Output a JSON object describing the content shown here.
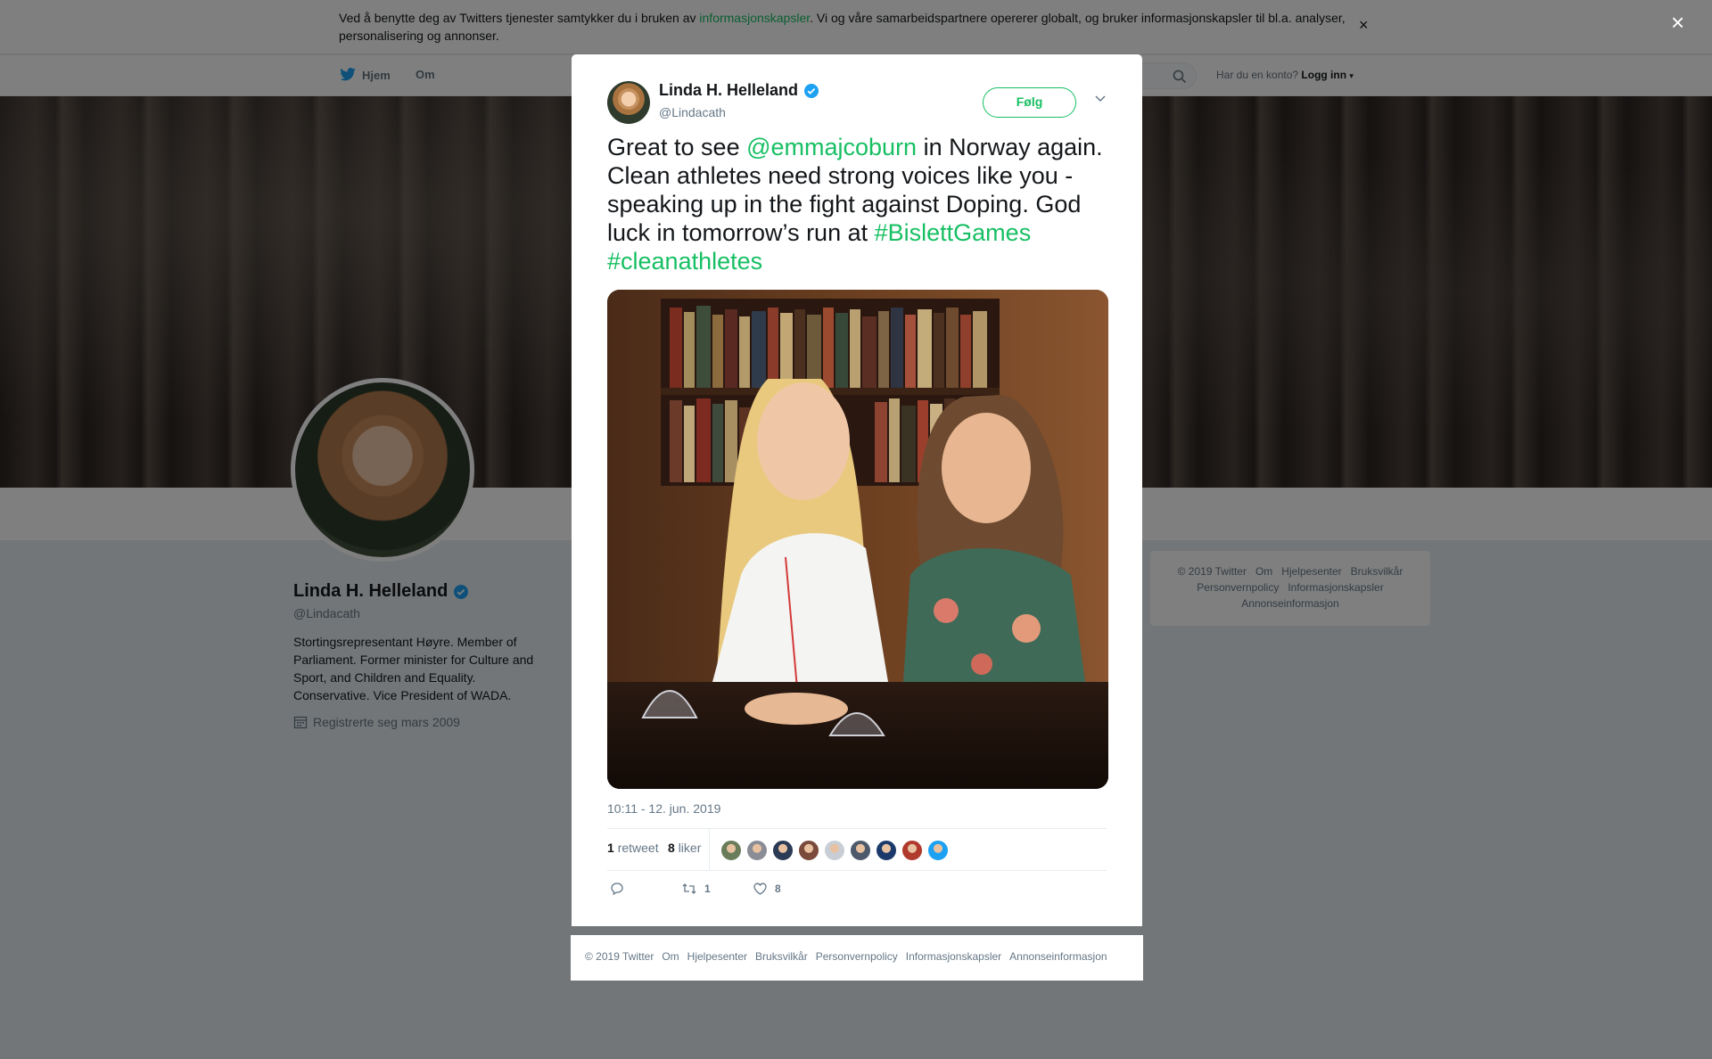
{
  "cookie_banner": {
    "text_before": "Ved å benytte deg av Twitters tjenester samtykker du i bruken av ",
    "link": "informasjonskapsler",
    "text_after": ". Vi og våre samarbeidspartnere opererer globalt, og bruker informasjonskapsler til bl.a. analyser, personalisering og annonser.",
    "close": "×"
  },
  "nav": {
    "home": "Hjem",
    "about": "Om",
    "have_account": "Har du en konto?",
    "login": "Logg inn"
  },
  "profile": {
    "name": "Linda H. Helleland",
    "handle": "@Lindacath",
    "bio": "Stortingsrepresentant Høyre. Member of Parliament. Former minister for Culture and Sport, and Children and Equality. Conservative. Vice President of WADA.",
    "joined": "Registrerte seg mars 2009"
  },
  "side_footer": {
    "row1": [
      "© 2019 Twitter",
      "Om",
      "Hjelpesenter",
      "Bruksvilkår"
    ],
    "row2": [
      "Personvernpolicy",
      "Informasjonskapsler"
    ],
    "row3": [
      "Annonseinformasjon"
    ]
  },
  "overlay": {
    "close": "×"
  },
  "tweet": {
    "author_name": "Linda H. Helleland",
    "author_handle": "@Lindacath",
    "follow_label": "Følg",
    "text": {
      "p1": "Great to see ",
      "mention": "@emmajcoburn",
      "p2": " in Norway again. Clean athletes need strong voices like you - speaking up in the fight against Doping. God luck in tomorrow’s run at ",
      "hashtag1": "#BislettGames",
      "hashtag2": "#cleanathletes"
    },
    "timestamp": "10:11 - 12. jun. 2019",
    "retweet_count": "1",
    "retweet_label": "retweet",
    "like_count": "8",
    "like_label": "liker",
    "actions": {
      "reply_count": "",
      "retweet_count": "1",
      "like_count": "8"
    }
  },
  "likers": [
    {
      "color": "#6a7d5a"
    },
    {
      "color": "#8a8c96"
    },
    {
      "color": "#2b3a55"
    },
    {
      "color": "#7a4a3a"
    },
    {
      "color": "#c9ced6"
    },
    {
      "color": "#4d5a6b"
    },
    {
      "color": "#1b3a6b"
    },
    {
      "color": "#b03a2e"
    },
    {
      "color": "#1da1f2"
    }
  ],
  "modal_footer": [
    "© 2019 Twitter",
    "Om",
    "Hjelpesenter",
    "Bruksvilkår",
    "Personvernpolicy",
    "Informasjonskapsler",
    "Annonseinformasjon"
  ],
  "colors": {
    "accent": "#17bf63",
    "verified": "#1da1f2",
    "muted": "#657786"
  }
}
